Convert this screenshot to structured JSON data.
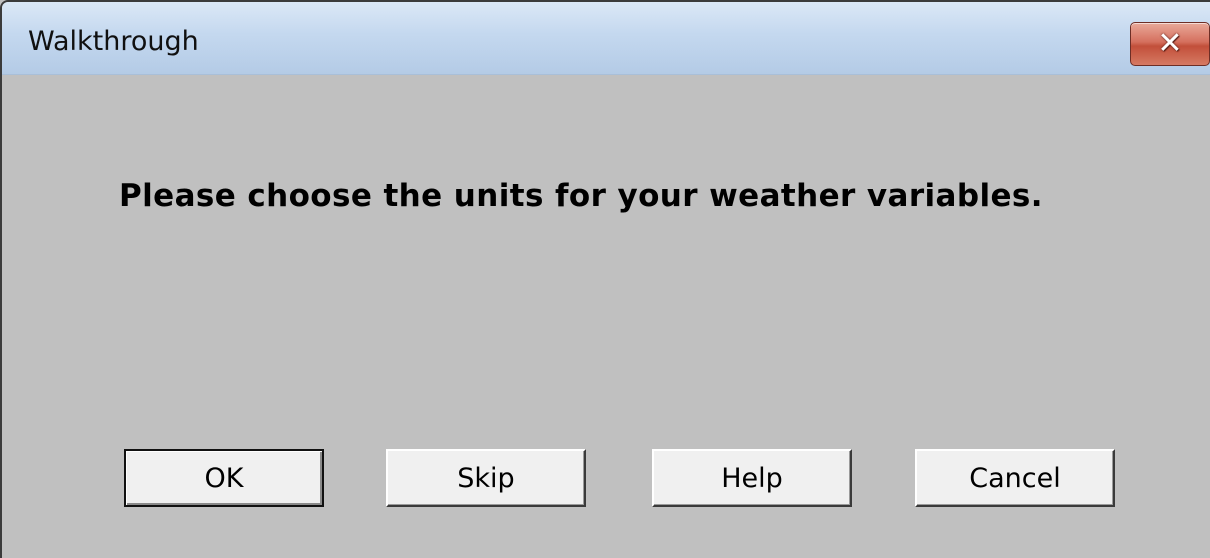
{
  "window": {
    "title": "Walkthrough",
    "close_icon": "close-icon"
  },
  "message": "Please choose the units for your weather variables.",
  "buttons": {
    "ok": "OK",
    "skip": "Skip",
    "help": "Help",
    "cancel": "Cancel"
  },
  "colors": {
    "dialog_background": "#c0c0c0",
    "titlebar": "#c4d8ef",
    "close_button": "#c24f3a",
    "button_face": "#f0f0f0"
  }
}
